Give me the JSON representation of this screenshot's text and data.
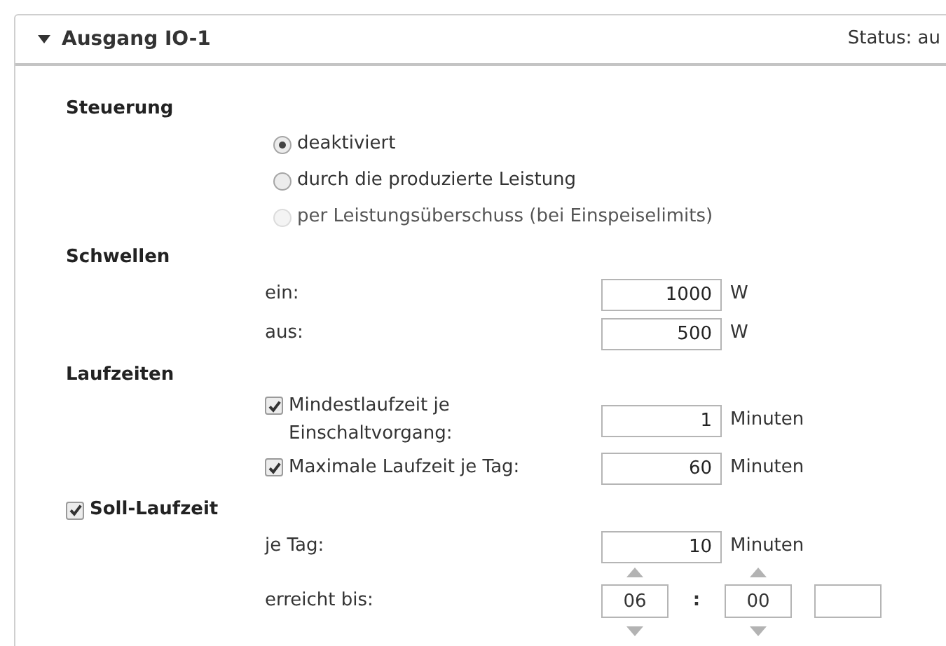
{
  "panel": {
    "title": "Ausgang IO-1",
    "expanded": true,
    "status": "Status: au"
  },
  "sections": [
    {
      "kind": "radio",
      "title": "Steuerung",
      "options": [
        {
          "label": "deaktiviert",
          "selected": true,
          "disabled": false
        },
        {
          "label": "durch die produzierte Leistung",
          "selected": false,
          "disabled": false
        },
        {
          "label": "per Leistungsüberschuss (bei Einspeiselimits)",
          "selected": false,
          "disabled": true
        }
      ]
    },
    {
      "kind": "fields",
      "title": "Schwellen",
      "rows": [
        {
          "kind": "number",
          "label": "ein:",
          "value": "1000",
          "unit": "W"
        },
        {
          "kind": "number",
          "label": "aus:",
          "value": "500",
          "unit": "W"
        }
      ]
    },
    {
      "kind": "fields",
      "title": "Laufzeiten",
      "rows": [
        {
          "kind": "check",
          "label": "Mindestlaufzeit je Einschaltvorgang:",
          "checked": true,
          "value": "1",
          "unit": "Minuten"
        },
        {
          "kind": "check",
          "label": "Maximale Laufzeit je Tag:",
          "checked": true,
          "value": "60",
          "unit": "Minuten"
        }
      ]
    },
    {
      "kind": "fields",
      "title": "Soll-Laufzeit",
      "checked": true,
      "rows": [
        {
          "kind": "number",
          "label": "je Tag:",
          "value": "10",
          "unit": "Minuten"
        },
        {
          "kind": "time",
          "label": "erreicht bis:",
          "hours": "06",
          "separator": ":",
          "minutes": "00"
        }
      ]
    }
  ]
}
